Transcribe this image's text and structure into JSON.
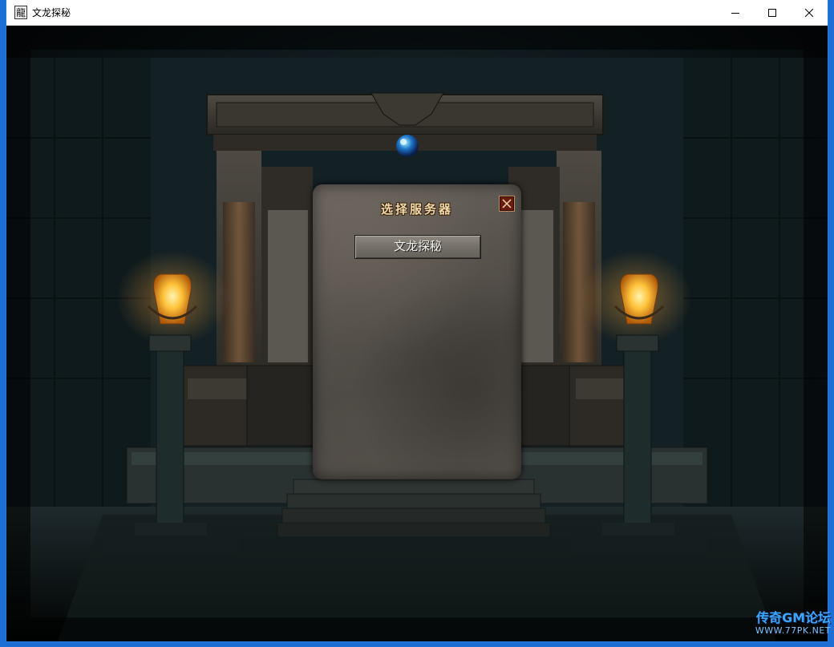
{
  "window": {
    "title": "文龙探秘",
    "icon_glyph": "龍",
    "controls": [
      "minimize-icon",
      "maximize-icon",
      "close-icon"
    ]
  },
  "dialog": {
    "title": "选择服务器",
    "close_icon": "close-icon",
    "servers": [
      {
        "label": "文龙探秘"
      }
    ]
  },
  "watermark": {
    "text": "传奇GM论坛",
    "url": "WWW.77PK.NET"
  },
  "colors": {
    "dialog_title": "#f0d9a8",
    "close_button_bg": "#6a1b10",
    "watermark": "#3fa4ff"
  }
}
